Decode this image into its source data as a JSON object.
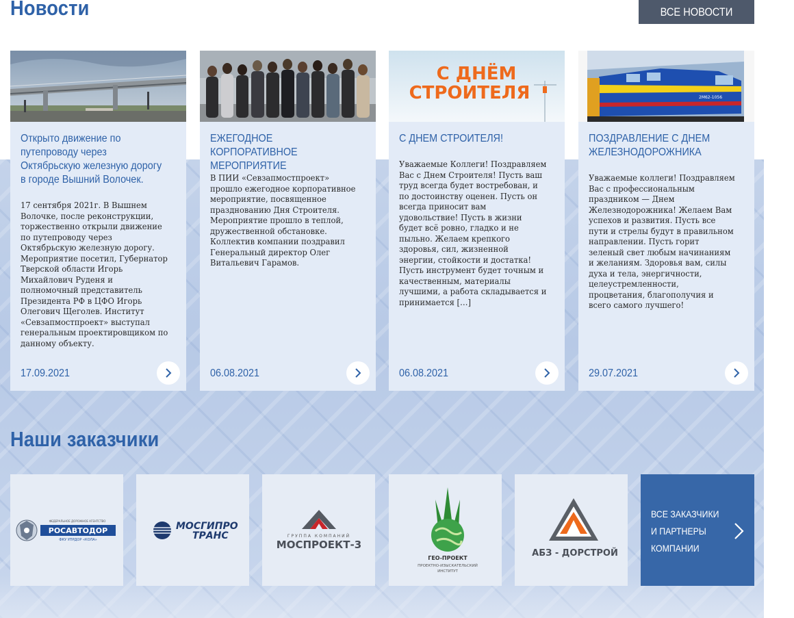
{
  "news": {
    "title": "Новости",
    "all_button": "Все новости",
    "items": [
      {
        "title": "Открыто движение по путепроводу через Октябрьскую железную дорогу в городе Вышний Волочек.",
        "text": "17 сентября 2021г. В Вышнем Волочке, после реконструкции, торжественно открыли движение по путепроводу через Октябрьскую железную дорогу. Мероприятие посетил, Губернатор Тверской области Игорь Михайлович Руденя и полномочный представитель Президента РФ в ЦФО Игорь Олегович Щеголев. Институт «Севзапмостпроект» выступал генеральным проектировщиком по данному объекту.",
        "date": "17.09.2021"
      },
      {
        "title": "ЕЖЕГОДНОЕ КОРПОРАТИВНОЕ МЕРОПРИЯТИЕ",
        "text": "В ПИИ «Севзапмостпроект» прошло ежегодное корпоративное мероприятие, посвященное празднованию Дня Строителя. Мероприятие прошло в теплой, дружественной обстановке. Коллектив компании поздравил Генеральный директор Олег Витальевич Гарамов.",
        "date": "06.08.2021"
      },
      {
        "title": "С ДНЕМ СТРОИТЕЛЯ!",
        "image_text_1": "С ДНЁМ",
        "image_text_2": "СТРОИТЕЛЯ",
        "text": "Уважаемые Коллеги! Поздравляем Вас с Днем Строителя! Пусть ваш труд всегда будет востребован, и по достоинству оценен. Пусть он всегда приносит вам удовольствие! Пусть в жизни будет всё ровно, гладко и не пыльно. Желаем крепкого здоровья, сил, жизненной энергии, стойкости и достатка! Пусть инструмент будет точным и качественным, материалы лучшими, а работа складывается и принимается […]",
        "date": "06.08.2021"
      },
      {
        "title": "ПОЗДРАВЛЕНИЕ С ДНЕМ ЖЕЛЕЗНОДОРОЖНИКА",
        "image_text": "2М62-1056",
        "text": "Уважаемые коллеги! Поздравляем Вас с профессиональным праздником — Днем Железнодорожника! Желаем Вам успехов и развития. Пусть все пути и стрелы будут в правильном направлении. Пусть горит зеленый свет любым начинаниям и желаниям. Здоровья вам, силы духа и тела, энергичности, целеустремленности, процветания, благополучия и всего самого лучшего!",
        "date": "29.07.2021"
      }
    ]
  },
  "clients": {
    "title": "Наши заказчики",
    "logos": [
      {
        "name": "rosavtodor",
        "small_top": "ФЕДЕРАЛЬНОЕ ДОРОЖНОЕ АГЕНТСТВО",
        "main": "РОСАВТОДОР",
        "sub": "ФКУ УПРДОР «КОЛА»"
      },
      {
        "name": "mosgiprotrans",
        "line1": "МОСГИПРО",
        "line2": "ТРАНС"
      },
      {
        "name": "mosproekt-3",
        "small": "ГРУППА КОМПАНИЙ",
        "main": "МОСПРОЕКТ-3"
      },
      {
        "name": "geo-proekt",
        "main": "ГЕО-ПРОЕКТ",
        "sub1": "ПРОЕКТНО-ИЗЫСКАТЕЛЬСКИЙ",
        "sub2": "ИНСТИТУТ"
      },
      {
        "name": "abz-dorstroy",
        "main": "АБЗ - ДОРСТРОЙ"
      }
    ],
    "all_button_lines": [
      "Все заказчики",
      "и партнеры",
      "компании"
    ]
  },
  "colors": {
    "accent": "#2f62a8",
    "card_bg": "#e3ebf7",
    "button_dark": "#4e596b",
    "button_blue": "#3767a8",
    "logo_orange": "#ee6a1c",
    "logo_green": "#2e8b35"
  },
  "icons": {
    "card_arrow": "chevron-right-icon",
    "all_clients_arrow": "chevron-right-icon"
  }
}
